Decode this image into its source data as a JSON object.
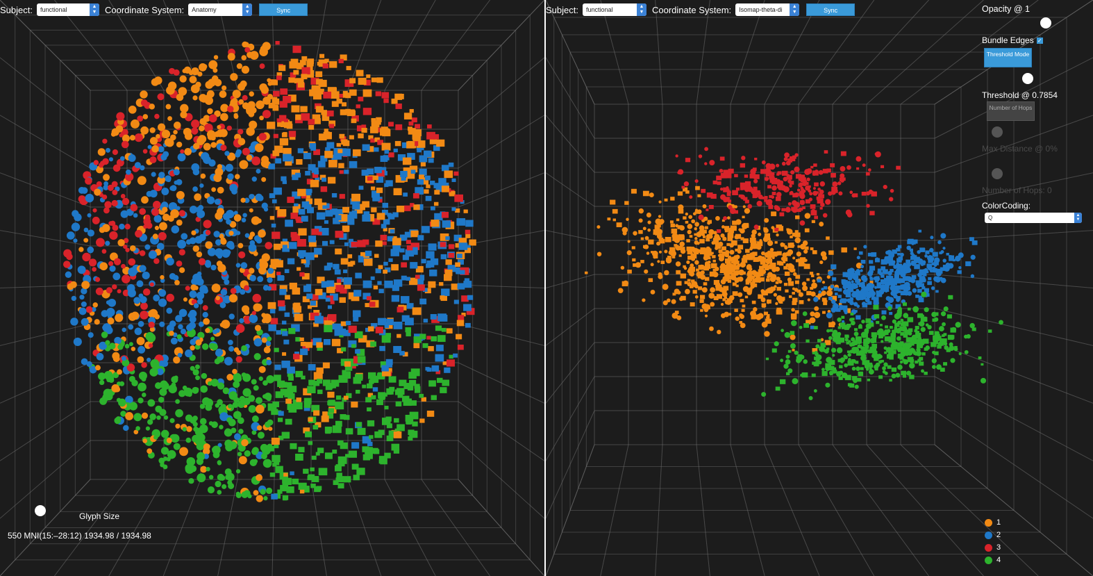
{
  "left": {
    "subject_label": "Subject:",
    "subject_value": "functional",
    "coord_label": "Coordinate System:",
    "coord_value": "Anatomy",
    "sync_label": "Sync",
    "glyph_size_label": "Glyph Size",
    "status_text": "550 MNI(15:–28:12) 1934.98 / 1934.98"
  },
  "right": {
    "subject_label": "Subject:",
    "subject_value": "functional",
    "coord_label": "Coordinate System:",
    "coord_value": "Isomap-theta-di",
    "sync_label": "Sync",
    "opacity_label": "Opacity @ 1",
    "bundle_edges_label": "Bundle Edges",
    "bundle_edges_checked": true,
    "threshold_mode_label": "Threshold Mode",
    "threshold_label": "Threshold @ 0.7854",
    "number_of_hops_button": "Number of Hops",
    "max_distance_label": "Max Distance @ 0%",
    "number_of_hops_label": "Number of Hops: 0",
    "color_coding_label": "ColorCoding:",
    "color_coding_value": "Q",
    "legend": [
      {
        "label": "1",
        "color": "#f28a14"
      },
      {
        "label": "2",
        "color": "#1f78c8"
      },
      {
        "label": "3",
        "color": "#d9232a"
      },
      {
        "label": "4",
        "color": "#2db32d"
      }
    ]
  },
  "colors": {
    "background": "#1c1c1c",
    "grid": "#6e6e6e",
    "accent": "#3a9ad9"
  }
}
